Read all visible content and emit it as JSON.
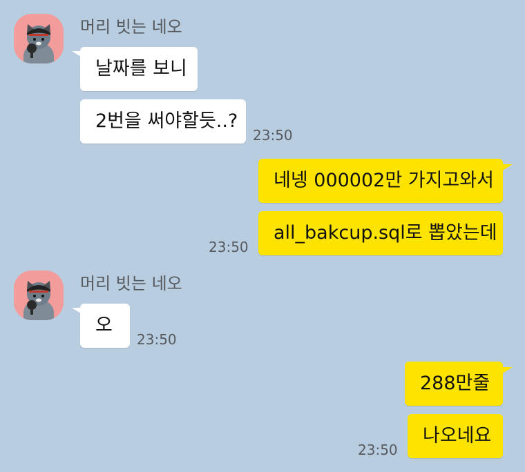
{
  "chat": {
    "groups": [
      {
        "sender": "머리 빗는 네오",
        "avatar_icon": "neo-cat-avatar-icon",
        "messages": [
          "날짜를 보니",
          "2번을 써야할듯..?"
        ],
        "time": "23:50"
      },
      {
        "sender": "me",
        "messages": [
          "네넹 000002만 가지고와서",
          "all_bakcup.sql로 뽑았는데"
        ],
        "time": "23:50"
      },
      {
        "sender": "머리 빗는 네오",
        "avatar_icon": "neo-cat-avatar-icon",
        "messages": [
          "오"
        ],
        "time": "23:50"
      },
      {
        "sender": "me",
        "messages": [
          "288만줄",
          "나오네요"
        ],
        "time": "23:50"
      }
    ]
  },
  "colors": {
    "background": "#b9cde0",
    "incoming_bubble": "#ffffff",
    "outgoing_bubble": "#fde400",
    "avatar_bg": "#f29c9c"
  }
}
